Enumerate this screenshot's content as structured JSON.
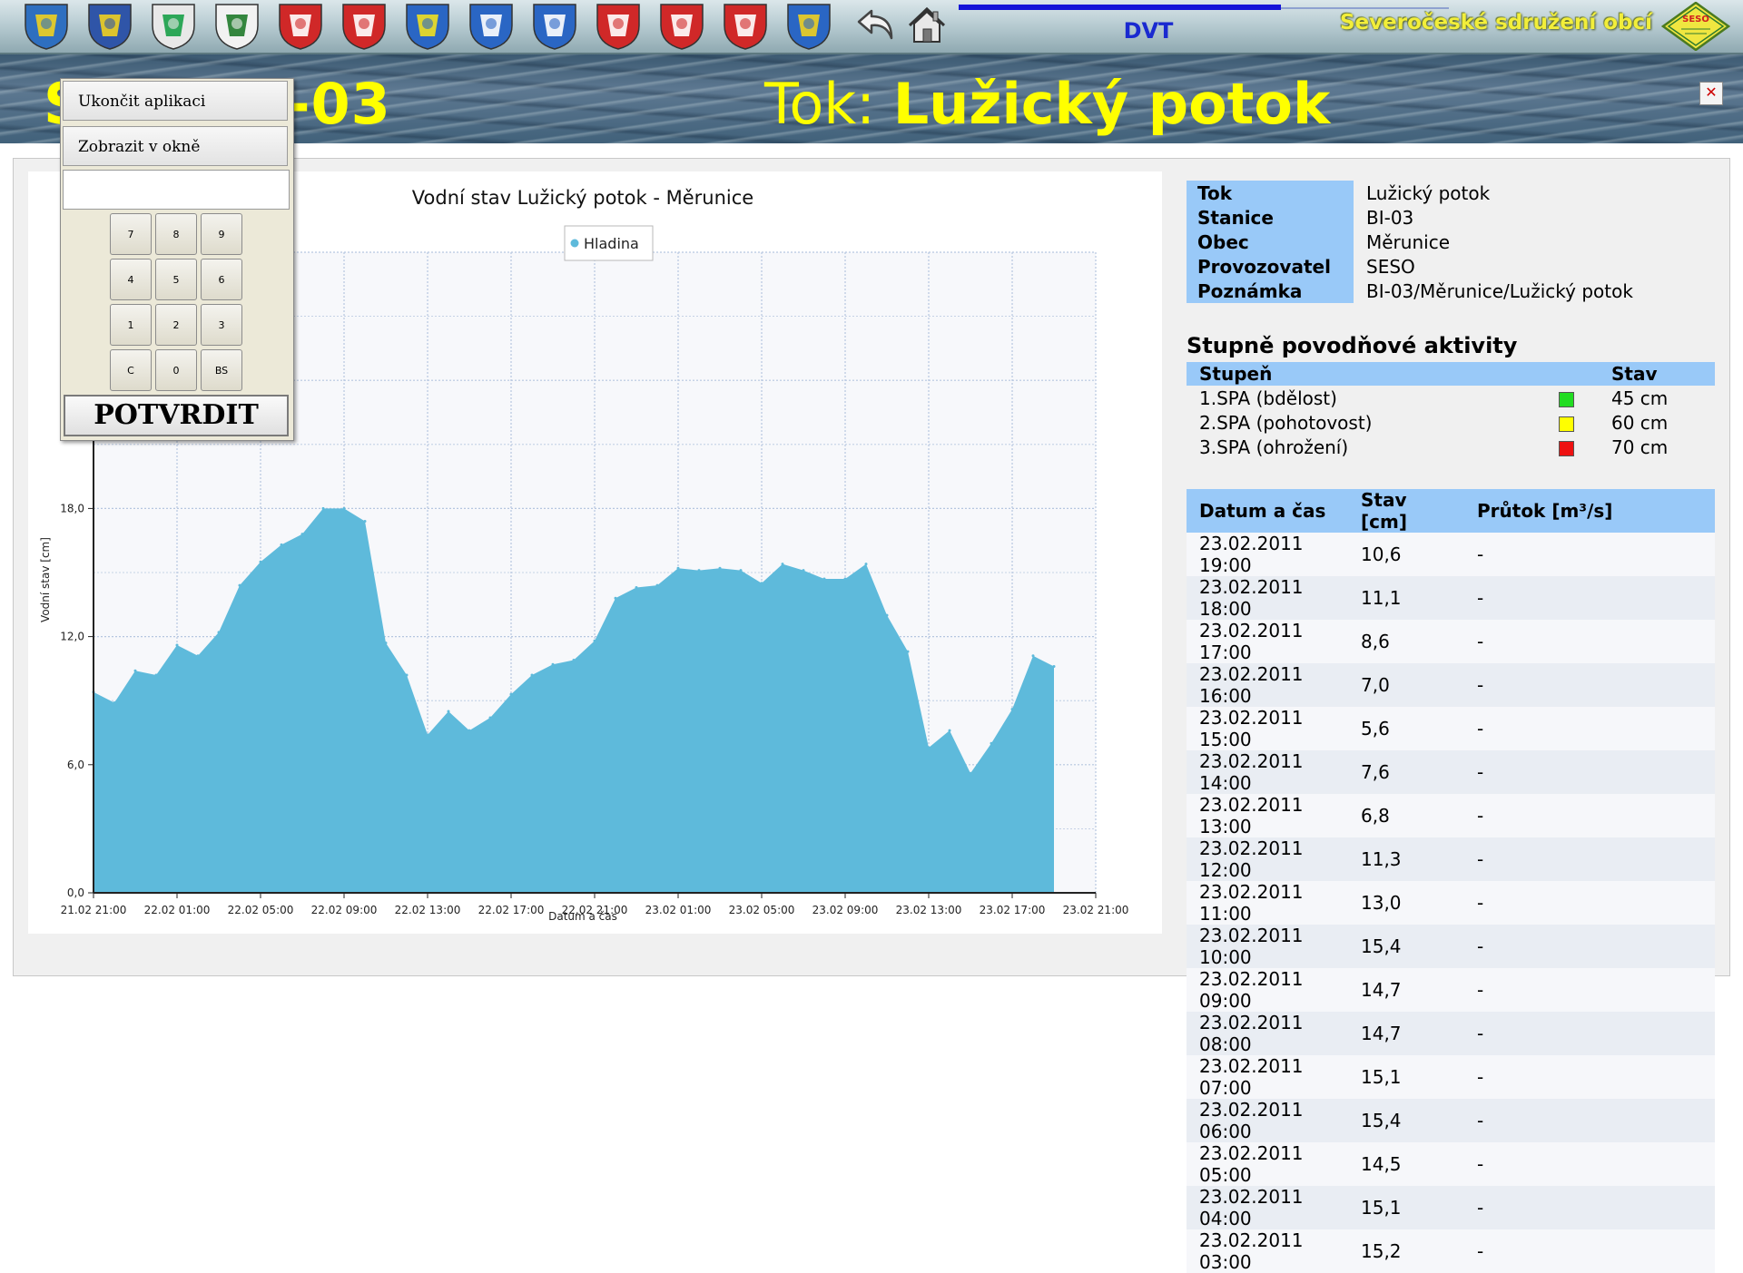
{
  "header": {
    "dvt_label": "DVT",
    "organization": "Severočeské sdružení obcí",
    "logo_text": "SESO",
    "crests": [
      {
        "icon": "lion-crest-icon",
        "bg": "#2e6fc0",
        "fg": "#f0d020"
      },
      {
        "icon": "cross-crest-icon",
        "bg": "#2f55a8",
        "fg": "#f0d020"
      },
      {
        "icon": "stripes-crest-icon",
        "bg": "#e8e8e8",
        "fg": "#18a048"
      },
      {
        "icon": "tree-crest-icon",
        "bg": "#f2f2f2",
        "fg": "#1f7a2a"
      },
      {
        "icon": "castle-lion-crest-icon",
        "bg": "#d02828",
        "fg": "#ffffff"
      },
      {
        "icon": "ram-crest-icon",
        "bg": "#d02828",
        "fg": "#ffffff"
      },
      {
        "icon": "flower-crest-icon",
        "bg": "#2a66c4",
        "fg": "#f0e020"
      },
      {
        "icon": "lily-crest-icon",
        "bg": "#2a66c4",
        "fg": "#ffffff"
      },
      {
        "icon": "tower-crest-icon",
        "bg": "#2a66c4",
        "fg": "#ffffff"
      },
      {
        "icon": "wing-crest-icon",
        "bg": "#d02828",
        "fg": "#ffffff"
      },
      {
        "icon": "gate-crest-icon",
        "bg": "#d02828",
        "fg": "#ffffff"
      },
      {
        "icon": "lion-red-crest-icon",
        "bg": "#d02828",
        "fg": "#ffffff"
      },
      {
        "icon": "eagle-crest-icon",
        "bg": "#2a66c4",
        "fg": "#f0d020"
      }
    ]
  },
  "banner": {
    "station_prefix": "S",
    "station_suffix": "I-03",
    "river_label": "Tok: ",
    "river_name": "Lužický potok",
    "close_symbol": "✕"
  },
  "popup": {
    "menu": [
      "Ukončit aplikaci",
      "Zobrazit v okně"
    ],
    "input_value": "",
    "keys": [
      "7",
      "8",
      "9",
      "4",
      "5",
      "6",
      "1",
      "2",
      "3",
      "C",
      "0",
      "BS"
    ],
    "confirm": "POTVRDIT"
  },
  "info": [
    {
      "label": "Tok",
      "value": "Lužický potok"
    },
    {
      "label": "Stanice",
      "value": "BI-03"
    },
    {
      "label": "Obec",
      "value": "Měrunice"
    },
    {
      "label": "Provozovatel",
      "value": "SESO"
    },
    {
      "label": "Poznámka",
      "value": "BI-03/Měrunice/Lužický potok"
    }
  ],
  "spa": {
    "title": "Stupně povodňové aktivity",
    "header_stage": "Stupeň",
    "header_state": "Stav",
    "rows": [
      {
        "stage": "1.SPA (bdělost)",
        "color": "#22dd22",
        "value": "45 cm"
      },
      {
        "stage": "2.SPA (pohotovost)",
        "color": "#ffff00",
        "value": "60 cm"
      },
      {
        "stage": "3.SPA (ohrožení)",
        "color": "#ee1111",
        "value": "70 cm"
      }
    ]
  },
  "measurements": {
    "headers": [
      "Datum a čas",
      "Stav [cm]",
      "Průtok [m³/s]"
    ],
    "rows": [
      [
        "23.02.2011 19:00",
        "10,6",
        "-"
      ],
      [
        "23.02.2011 18:00",
        "11,1",
        "-"
      ],
      [
        "23.02.2011 17:00",
        "8,6",
        "-"
      ],
      [
        "23.02.2011 16:00",
        "7,0",
        "-"
      ],
      [
        "23.02.2011 15:00",
        "5,6",
        "-"
      ],
      [
        "23.02.2011 14:00",
        "7,6",
        "-"
      ],
      [
        "23.02.2011 13:00",
        "6,8",
        "-"
      ],
      [
        "23.02.2011 12:00",
        "11,3",
        "-"
      ],
      [
        "23.02.2011 11:00",
        "13,0",
        "-"
      ],
      [
        "23.02.2011 10:00",
        "15,4",
        "-"
      ],
      [
        "23.02.2011 09:00",
        "14,7",
        "-"
      ],
      [
        "23.02.2011 08:00",
        "14,7",
        "-"
      ],
      [
        "23.02.2011 07:00",
        "15,1",
        "-"
      ],
      [
        "23.02.2011 06:00",
        "15,4",
        "-"
      ],
      [
        "23.02.2011 05:00",
        "14,5",
        "-"
      ],
      [
        "23.02.2011 04:00",
        "15,1",
        "-"
      ],
      [
        "23.02.2011 03:00",
        "15,2",
        "-"
      ]
    ]
  },
  "chart_data": {
    "type": "area",
    "title": "Vodní stav Lužický potok - Měrunice",
    "legend": [
      "Hladina"
    ],
    "legend_position": "top-center",
    "xlabel": "Datum a čas",
    "ylabel": "Vodní stav [cm]",
    "ylim": [
      0,
      30
    ],
    "y_ticks": [
      0,
      6,
      12,
      18
    ],
    "y_tick_labels": [
      "0,0",
      "6,0",
      "12,0",
      "18,0"
    ],
    "x_tick_labels": [
      "21.02 21:00",
      "22.02 01:00",
      "22.02 05:00",
      "22.02 09:00",
      "22.02 13:00",
      "22.02 17:00",
      "22.02 21:00",
      "23.02 01:00",
      "23.02 05:00",
      "23.02 09:00",
      "23.02 13:00",
      "23.02 17:00",
      "23.02 21:00"
    ],
    "x_range_hours": [
      0,
      48
    ],
    "grid": true,
    "color": "#5ebadb",
    "series": [
      {
        "name": "Hladina",
        "x_hours": [
          0,
          1,
          2,
          3,
          4,
          5,
          6,
          7,
          8,
          9,
          10,
          11,
          12,
          13,
          14,
          15,
          16,
          17,
          18,
          19,
          20,
          21,
          22,
          23,
          24,
          25,
          26,
          27,
          28,
          29,
          30,
          31,
          32,
          33,
          34,
          35,
          36,
          37,
          38,
          39,
          40,
          41,
          42,
          43,
          44,
          45,
          46
        ],
        "values": [
          9.4,
          8.9,
          10.4,
          10.2,
          11.6,
          11.1,
          12.2,
          14.4,
          15.5,
          16.3,
          16.8,
          18.0,
          18.0,
          17.4,
          11.7,
          10.2,
          7.4,
          8.5,
          7.6,
          8.2,
          9.3,
          10.2,
          10.7,
          10.9,
          11.8,
          13.8,
          14.3,
          14.4,
          15.2,
          15.1,
          15.2,
          15.1,
          14.5,
          15.4,
          15.1,
          14.7,
          14.7,
          15.4,
          13.0,
          11.3,
          6.8,
          7.6,
          5.6,
          7.0,
          8.6,
          11.1,
          10.6
        ]
      }
    ]
  }
}
